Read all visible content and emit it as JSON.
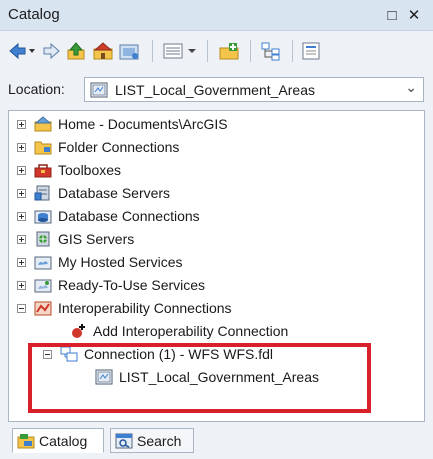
{
  "window": {
    "title": "Catalog",
    "restore_label": "□",
    "close_label": "✕"
  },
  "toolbar": {
    "buttons": [
      "back-arrow-icon",
      "forward-arrow-icon",
      "up-one-level-icon",
      "home-folder-icon",
      "connect-folder-icon",
      "view-options-icon",
      "new-item-icon",
      "tree-toggle-icon",
      "metadata-icon"
    ]
  },
  "location": {
    "label": "Location:",
    "value": "LIST_Local_Government_Areas"
  },
  "tree": {
    "items": [
      {
        "label": "Home - Documents\\ArcGIS",
        "icon": "home-folder-icon",
        "expander": "plus"
      },
      {
        "label": "Folder Connections",
        "icon": "folder-icon",
        "expander": "plus"
      },
      {
        "label": "Toolboxes",
        "icon": "toolbox-icon",
        "expander": "plus"
      },
      {
        "label": "Database Servers",
        "icon": "database-server-icon",
        "expander": "plus"
      },
      {
        "label": "Database Connections",
        "icon": "database-connection-icon",
        "expander": "plus"
      },
      {
        "label": "GIS Servers",
        "icon": "gis-server-icon",
        "expander": "plus"
      },
      {
        "label": "My Hosted Services",
        "icon": "hosted-services-icon",
        "expander": "plus"
      },
      {
        "label": "Ready-To-Use Services",
        "icon": "ready-services-icon",
        "expander": "plus"
      },
      {
        "label": "Interoperability Connections",
        "icon": "interop-icon",
        "expander": "minus"
      },
      {
        "label": "Add Interoperability Connection",
        "icon": "add-interop-icon",
        "expander": "none"
      },
      {
        "label": "Connection (1) - WFS WFS.fdl",
        "icon": "connection-icon",
        "expander": "minus"
      },
      {
        "label": "LIST_Local_Government_Areas",
        "icon": "feature-class-icon",
        "expander": "none"
      }
    ]
  },
  "tabs": [
    {
      "label": "Catalog",
      "icon": "catalog-icon",
      "active": true
    },
    {
      "label": "Search",
      "icon": "search-window-icon",
      "active": false
    }
  ],
  "colors": {
    "highlight": "#d8202a",
    "titlebar": "#d9e4f1",
    "panel": "#eef2f7"
  }
}
